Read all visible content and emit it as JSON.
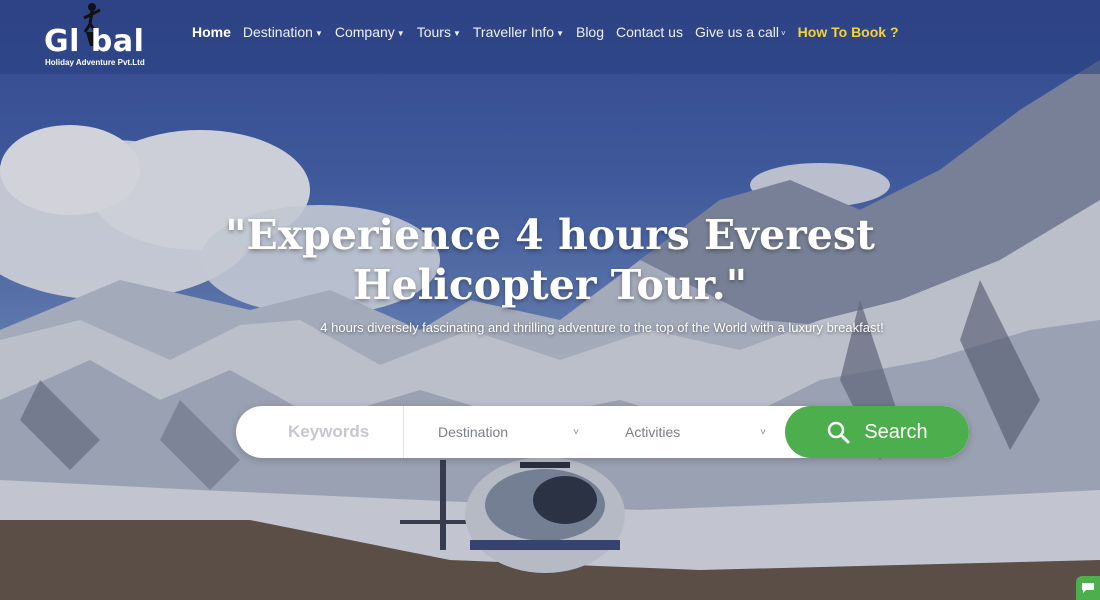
{
  "brand": {
    "name": "Gl bal",
    "tagline": "Holiday Adventure Pvt.Ltd"
  },
  "nav": {
    "items": [
      {
        "label": "Home",
        "dropdown": false,
        "active": true
      },
      {
        "label": "Destination",
        "dropdown": true
      },
      {
        "label": "Company",
        "dropdown": true
      },
      {
        "label": "Tours",
        "dropdown": true
      },
      {
        "label": "Traveller Info",
        "dropdown": true
      },
      {
        "label": "Blog",
        "dropdown": false
      },
      {
        "label": "Contact us",
        "dropdown": false
      },
      {
        "label": "Give us a call",
        "dropdown": true
      },
      {
        "label": "How To Book ?",
        "dropdown": false,
        "highlight": true
      }
    ]
  },
  "hero": {
    "headline_line1": "\"Experience 4 hours Everest",
    "headline_line2": "Helicopter Tour.\"",
    "subtitle": "4 hours diversely fascinating and thrilling adventure to the top of the World with a luxury breakfast!"
  },
  "search": {
    "keywords_placeholder": "Keywords",
    "destination_label": "Destination",
    "activities_label": "Activities",
    "button_label": "Search"
  },
  "colors": {
    "accent_green": "#4cae4c",
    "highlight_yellow": "#f5d33a",
    "sky_blue": "#3a54a0"
  }
}
